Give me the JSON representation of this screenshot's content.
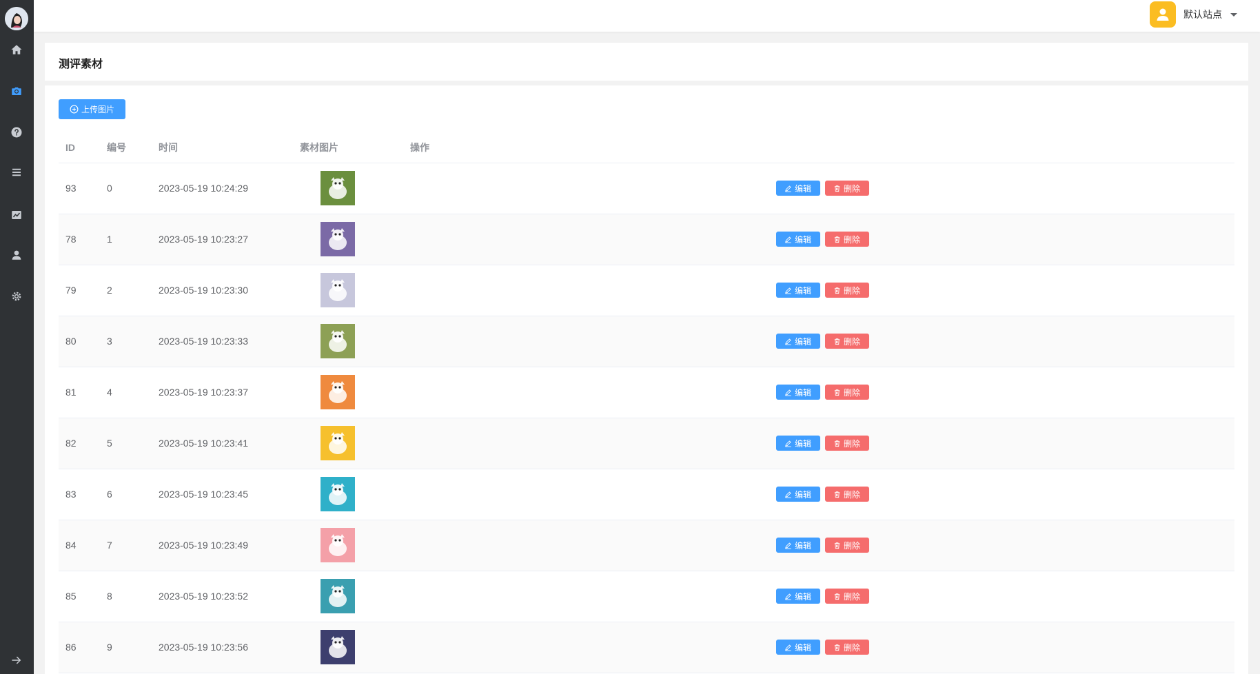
{
  "nav": {
    "items": [
      {
        "icon": "home-icon"
      },
      {
        "icon": "camera-icon"
      },
      {
        "icon": "help-icon"
      },
      {
        "icon": "list-icon"
      },
      {
        "icon": "chart-icon"
      },
      {
        "icon": "user-icon"
      },
      {
        "icon": "settings-icon"
      }
    ],
    "collapse_icon": "arrow-right-icon",
    "active_color": "#409eff"
  },
  "topbar": {
    "site_name": "默认站点"
  },
  "page": {
    "title": "测评素材",
    "upload_label": "上传图片"
  },
  "table": {
    "headers": {
      "id": "ID",
      "no": "编号",
      "time": "时间",
      "image": "素材图片",
      "actions": "操作"
    },
    "edit_label": "编辑",
    "delete_label": "删除",
    "rows": [
      {
        "id": "93",
        "no": "0",
        "time": "2023-05-19 10:24:29",
        "thumb_color": "#6b8f3e"
      },
      {
        "id": "78",
        "no": "1",
        "time": "2023-05-19 10:23:27",
        "thumb_color": "#7b6aa6"
      },
      {
        "id": "79",
        "no": "2",
        "time": "2023-05-19 10:23:30",
        "thumb_color": "#c7c7dc"
      },
      {
        "id": "80",
        "no": "3",
        "time": "2023-05-19 10:23:33",
        "thumb_color": "#8da055"
      },
      {
        "id": "81",
        "no": "4",
        "time": "2023-05-19 10:23:37",
        "thumb_color": "#ef8a3e"
      },
      {
        "id": "82",
        "no": "5",
        "time": "2023-05-19 10:23:41",
        "thumb_color": "#f6c02d"
      },
      {
        "id": "83",
        "no": "6",
        "time": "2023-05-19 10:23:45",
        "thumb_color": "#2fb0c9"
      },
      {
        "id": "84",
        "no": "7",
        "time": "2023-05-19 10:23:49",
        "thumb_color": "#f4a0a8"
      },
      {
        "id": "85",
        "no": "8",
        "time": "2023-05-19 10:23:52",
        "thumb_color": "#3a9fb0"
      },
      {
        "id": "86",
        "no": "9",
        "time": "2023-05-19 10:23:56",
        "thumb_color": "#3d3f6e"
      }
    ]
  },
  "colors": {
    "primary": "#409eff",
    "danger": "#f56c6c",
    "sidebar": "#2f3235",
    "site_avatar": "#fbbd22"
  }
}
